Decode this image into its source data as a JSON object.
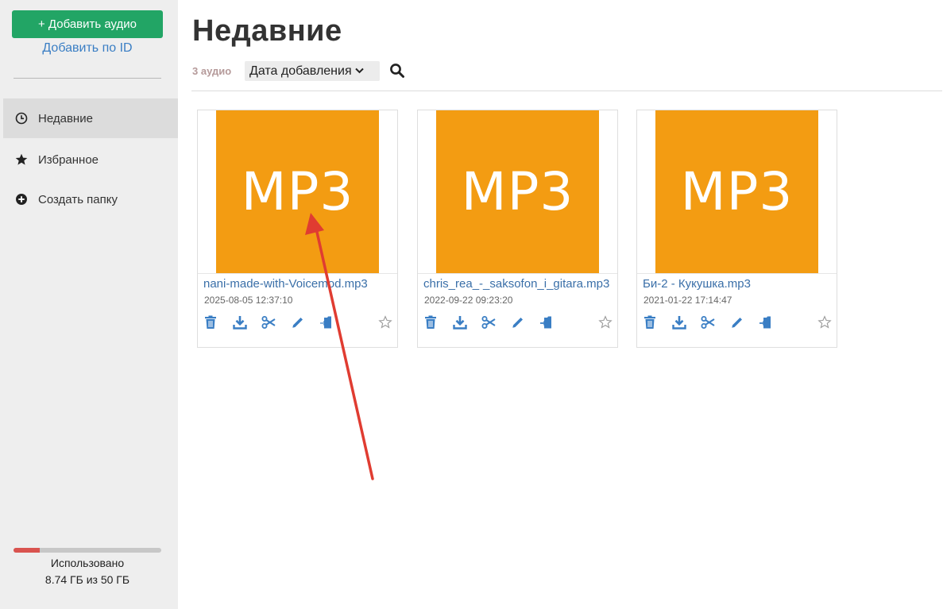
{
  "sidebar": {
    "add_audio_label": "+ Добавить аудио",
    "add_by_id_label": "Добавить по ID",
    "nav": [
      {
        "label": "Недавние",
        "icon": "clock-icon",
        "active": true
      },
      {
        "label": "Избранное",
        "icon": "star-icon",
        "active": false
      },
      {
        "label": "Создать папку",
        "icon": "plus-circle-icon",
        "active": false
      }
    ],
    "usage": {
      "label": "Использовано",
      "value": "8.74 ГБ из 50 ГБ",
      "fraction": 0.1748
    }
  },
  "main": {
    "title": "Недавние",
    "count": "3 аудио",
    "sort": {
      "selected": "Дата добавления"
    },
    "files": [
      {
        "thumb": "MP3",
        "name": "nani-made-with-Voicemod.mp3",
        "date": "2025-08-05 12:37:10"
      },
      {
        "thumb": "MP3",
        "name": "chris_rea_-_saksofon_i_gitara.mp3",
        "date": "2022-09-22 09:23:20"
      },
      {
        "thumb": "MP3",
        "name": "Би-2 - Кукушка.mp3",
        "date": "2021-01-22 17:14:47"
      }
    ]
  },
  "colors": {
    "primary_green": "#22a565",
    "link_blue": "#3a7ec4",
    "thumb_orange": "#f39c12",
    "usage_red": "#d9534f",
    "annotation_arrow": "#e03c31"
  }
}
